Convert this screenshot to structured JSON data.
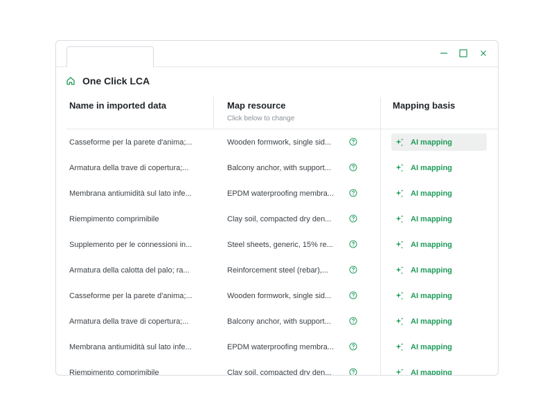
{
  "window": {
    "tab_label": ""
  },
  "brand": {
    "title": "One Click LCA"
  },
  "columns": {
    "name": "Name in imported data",
    "map": "Map resource",
    "map_sub": "Click below to change",
    "basis": "Mapping basis"
  },
  "rows": [
    {
      "name": "Casseforme per la parete d'anima;...",
      "resource": "Wooden formwork, single sid...",
      "basis": "AI mapping"
    },
    {
      "name": "Armatura della trave di copertura;...",
      "resource": "Balcony anchor, with support...",
      "basis": "AI mapping"
    },
    {
      "name": "Membrana antiumidità sul lato infe...",
      "resource": "EPDM waterproofing membra...",
      "basis": "AI mapping"
    },
    {
      "name": "Riempimento comprimibile",
      "resource": "Clay soil, compacted dry den...",
      "basis": "AI mapping"
    },
    {
      "name": "Supplemento per le connessioni in...",
      "resource": "Steel sheets, generic, 15% re...",
      "basis": "AI mapping"
    },
    {
      "name": "Armatura della calotta del palo; ra...",
      "resource": "Reinforcement steel (rebar),...",
      "basis": "AI mapping"
    },
    {
      "name": "Casseforme per la parete d'anima;...",
      "resource": "Wooden formwork, single sid...",
      "basis": "AI mapping"
    },
    {
      "name": "Armatura della trave di copertura;...",
      "resource": "Balcony anchor, with support...",
      "basis": "AI mapping"
    },
    {
      "name": "Membrana antiumidità sul lato infe...",
      "resource": "EPDM waterproofing membra...",
      "basis": "AI mapping"
    },
    {
      "name": "Riempimento comprimibile",
      "resource": "Clay soil, compacted dry den...",
      "basis": "AI mapping"
    }
  ],
  "colors": {
    "accent": "#1f9b5a",
    "border": "#d9dde1",
    "highlight": "#eeefef"
  },
  "icons": {
    "home": "home-icon",
    "help": "help-circle-icon",
    "ai": "sparkle-icon",
    "minimize": "minimize-icon",
    "maximize": "maximize-icon",
    "close": "close-icon"
  }
}
